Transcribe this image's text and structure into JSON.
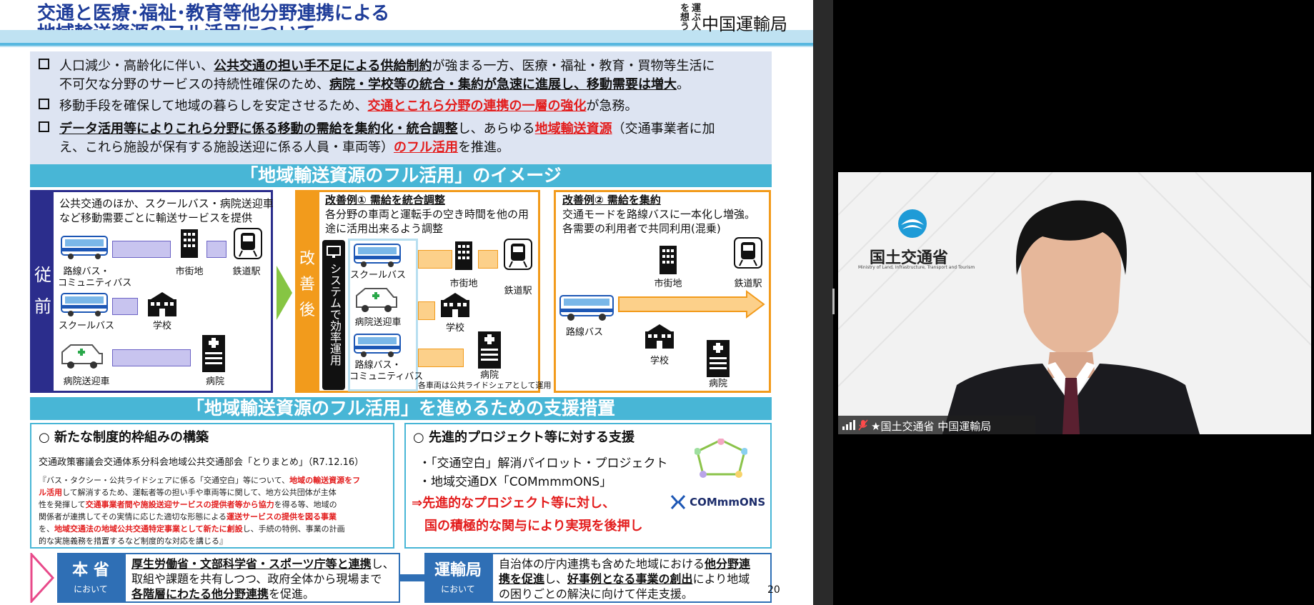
{
  "slide": {
    "title_line1": "交通と医療･福祉･教育等他分野連携による",
    "title_line2": "地域輸送資源のフル活用について",
    "agency": "中国運輸局",
    "logo_text": "運ぶ人を想う",
    "intro": {
      "b1_a": "人口減少・高齢化に伴い、",
      "b1_b": "公共交通の担い手不足による供給制約",
      "b1_c": "が強まる一方、医療・福祉・教育・買物等生活に",
      "b1_d": "不可欠な分野のサービスの持続性確保のため、",
      "b1_e": "病院・学校等の統合・集約が急速に進展し、移動需要は増大",
      "b1_f": "。",
      "b2_a": "移動手段を確保して地域の暮らしを安定させるため、",
      "b2_b": "交通とこれら分野の連携の一層の強化",
      "b2_c": "が急務。",
      "b3_a": "データ活用等によりこれら分野に係る移動の需給を集約化・統合調整",
      "b3_b": "し、あらゆる",
      "b3_c": "地域輸送資源",
      "b3_d": "（交通事業者に加",
      "b3_e": "え、これら施設が保有する施設送迎に係る人員・車両等）",
      "b3_f": "のフル活用",
      "b3_g": "を推進。"
    },
    "image_banner": "「地域輸送資源のフル活用」のイメージ",
    "before": {
      "side": [
        "従",
        "前"
      ],
      "desc1": "公共交通のほか、スクールバス・病院送迎車",
      "desc2": "など移動需要ごとに輸送サービスを提供",
      "bus": "路線バス・",
      "bus2": "コミュニティバス",
      "school_bus": "スクールバス",
      "hospital_car": "病院送迎車",
      "city": "市街地",
      "station": "鉄道駅",
      "school": "学校",
      "hospital": "病院"
    },
    "after": {
      "side": [
        "改",
        "善",
        "後"
      ],
      "system": "システムで効率運用",
      "ex1_title": "改善例① 需給を統合調整",
      "ex1_desc1": "各分野の車両と運転手の空き時間を他の用",
      "ex1_desc2": "途に活用出来るよう調整",
      "school_bus": "スクールバス",
      "hospital_car": "病院送迎車",
      "bus": "路線バス・",
      "bus2": "コミュニティバス",
      "city": "市街地",
      "station": "鉄道駅",
      "school": "学校",
      "hospital": "病院",
      "note": "各車両は公共ライドシェアとして運用",
      "ex2_title": "改善例② 需給を集約",
      "ex2_desc1": "交通モードを路線バスに一本化し増強。",
      "ex2_desc2": "各需要の利用者で共同利用(混乗)",
      "ex2_bus": "路線バス",
      "ex2_city": "市街地",
      "ex2_station": "鉄道駅",
      "ex2_school": "学校",
      "ex2_hospital": "病院"
    },
    "support_banner": "「地域輸送資源のフル活用」を進めるための支援措置",
    "left_box": {
      "head": "○ 新たな制度的枠組みの構築",
      "sub": "交通政策審議会交通体系分科会地域公共交通部会「とりまとめ」（R7.12.16）",
      "p1a": "『バス・タクシー・公共ライドシェアに係る「交通空白」等について、",
      "p1b": "地域の輸送資源をフ",
      "p2a": "ル活用",
      "p2b": "して解消するため、運転者等の担い手や車両等に関して、地方公共団体が主体",
      "p3a": "性を発揮して",
      "p3b": "交通事業者間や施設送迎サービスの提供者等から協力",
      "p3c": "を得る等、地域の",
      "p4a": "関係者が連携してその実情に応じた適切な形態による",
      "p4b": "運送サービスの提供を図る事業",
      "p5a": "を、",
      "p5b": "地域交通法の地域公共交通特定事業として新たに創設",
      "p5c": "し、手続の特例、事業の計画",
      "p6": "的な実施義務を措置するなど制度的な対応を講じる』"
    },
    "right_box": {
      "head": "○ 先進的プロジェクト等に対する支援",
      "i1": "・「交通空白」解消パイロット・プロジェクト",
      "i2": "・地域交通DX「COMmmmONS」",
      "r1": "⇒先進的なプロジェクト等に対し、",
      "r2": "国の積極的な関与により実現を後押し",
      "logo": "COMmmONS"
    },
    "bottom_left": {
      "tag": "本 省",
      "tag_sub": "において",
      "l1a": "厚生労働省・文部科学省・スポーツ庁等と連携",
      "l1b": "し、",
      "l2": "取組や課題を共有しつつ、政府全体から現場まで",
      "l3a": "各階層にわたる他分野連携",
      "l3b": "を促進。"
    },
    "bottom_right": {
      "tag": "運輸局",
      "tag_sub": "において",
      "l1a": "自治体の庁内連携も含めた地域における",
      "l1b": "他分野連",
      "l2a": "携を促進",
      "l2b": "し、",
      "l2c": "好事例となる事業の創出",
      "l2d": "により地域",
      "l3": "の困りごとの解決に向けて伴走支援。"
    },
    "page_number": "20"
  },
  "video": {
    "org_logo": "国土交通省",
    "org_sub": "Ministry of Land, Infrastructure, Transport and Tourism",
    "participant_name": "★国土交通省  中国運輸局"
  },
  "colors": {
    "title": "#1f3d99",
    "banner": "#48b6d6",
    "before": "#2b2d8c",
    "after": "#f29b1c",
    "red": "#e31d1d"
  }
}
